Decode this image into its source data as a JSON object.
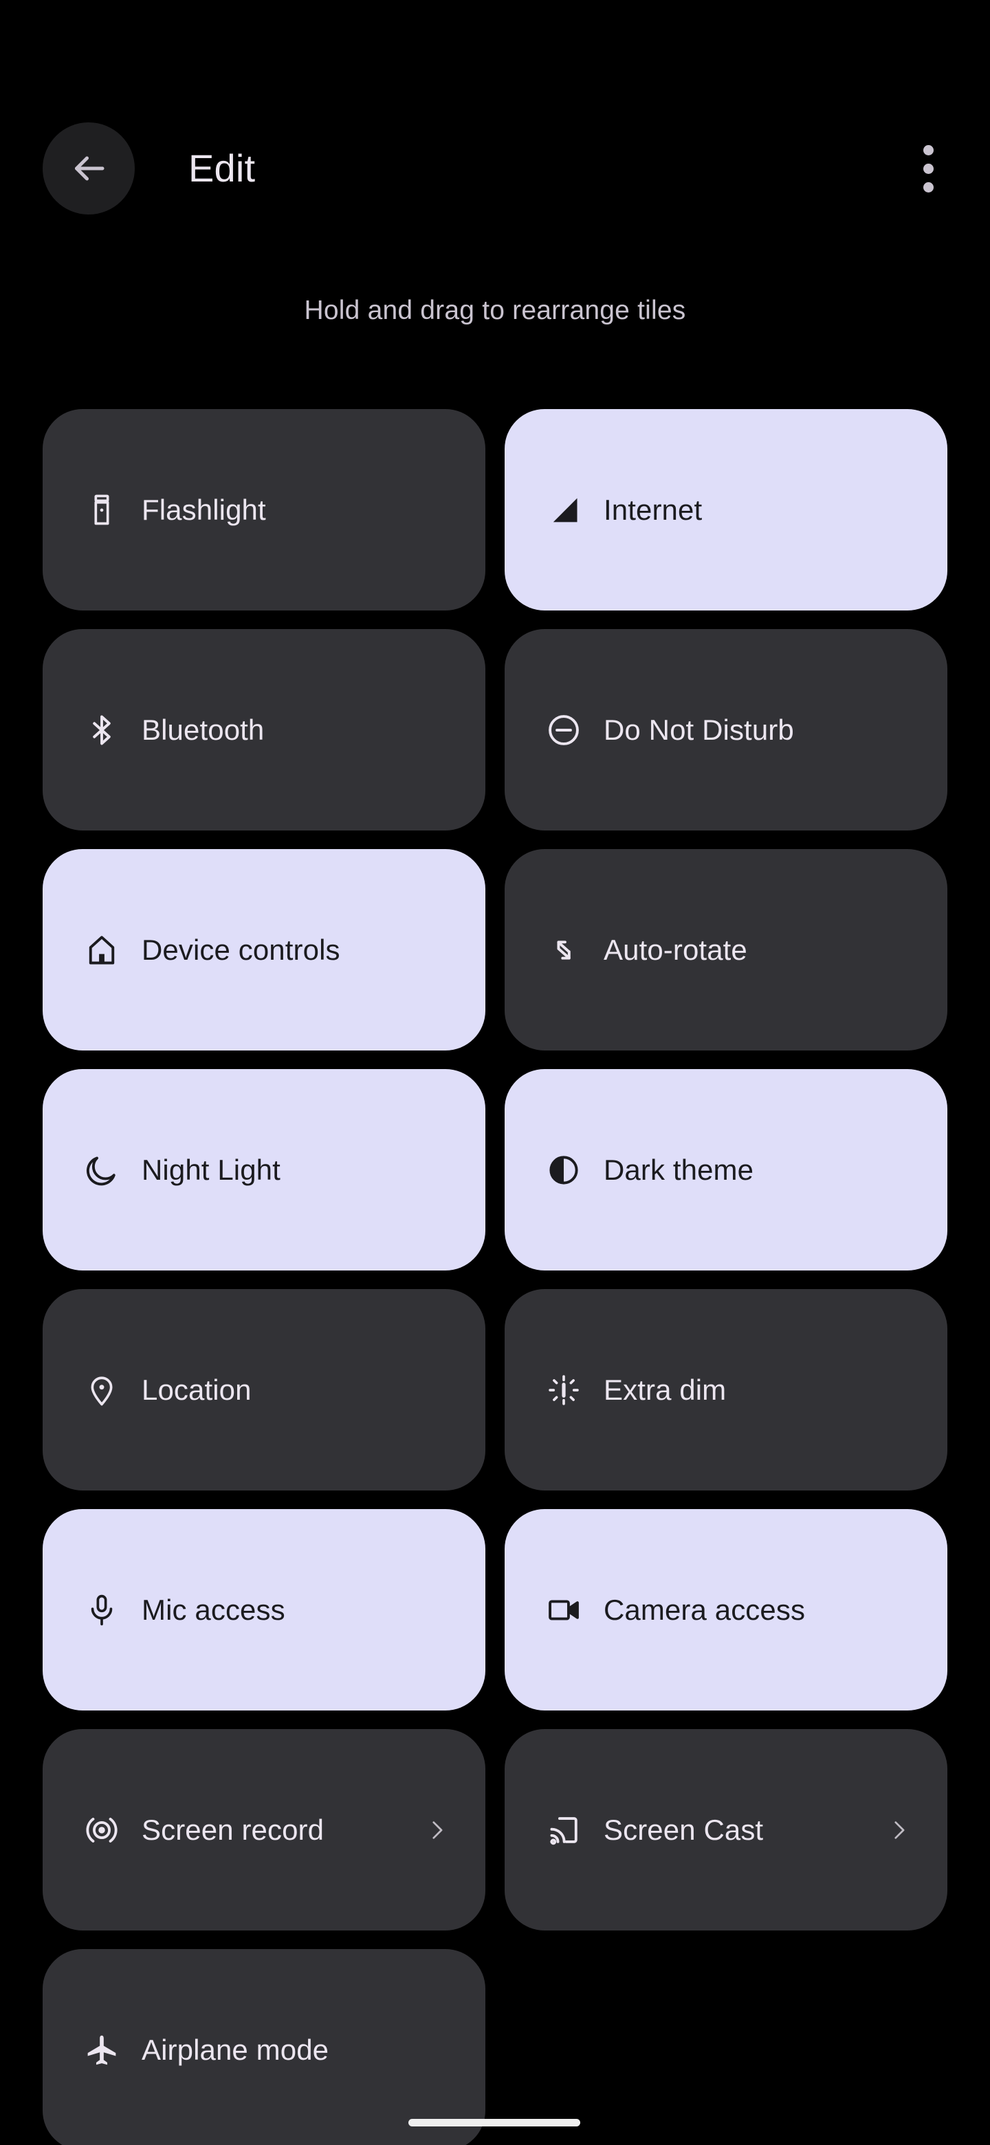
{
  "header": {
    "title": "Edit",
    "back_icon": "arrow-back-icon",
    "overflow_icon": "more-vert-icon"
  },
  "subtitle": "Hold and drag to rearrange tiles",
  "colors": {
    "background": "#000000",
    "tile_inactive_bg": "#323236",
    "tile_inactive_fg": "#ECE6F0",
    "tile_active_bg": "#DFDEF9",
    "tile_active_fg": "#1B1B1F",
    "header_fg": "#ECE6F0",
    "subtitle_fg": "#CAC4D0",
    "back_button_bg": "#1F1F21",
    "nav_pill": "#EFEFEF"
  },
  "tiles": [
    {
      "label": "Flashlight",
      "icon": "flashlight-icon",
      "state": "inactive",
      "chevron": false
    },
    {
      "label": "Internet",
      "icon": "signal-internet-icon",
      "state": "active",
      "chevron": false
    },
    {
      "label": "Bluetooth",
      "icon": "bluetooth-icon",
      "state": "inactive",
      "chevron": false
    },
    {
      "label": "Do Not Disturb",
      "icon": "do-not-disturb-icon",
      "state": "inactive",
      "chevron": false
    },
    {
      "label": "Device controls",
      "icon": "home-icon",
      "state": "active",
      "chevron": false
    },
    {
      "label": "Auto-rotate",
      "icon": "auto-rotate-icon",
      "state": "inactive",
      "chevron": false
    },
    {
      "label": "Night Light",
      "icon": "moon-icon",
      "state": "active",
      "chevron": false
    },
    {
      "label": "Dark theme",
      "icon": "dark-theme-icon",
      "state": "active",
      "chevron": false
    },
    {
      "label": "Location",
      "icon": "location-pin-icon",
      "state": "inactive",
      "chevron": false
    },
    {
      "label": "Extra dim",
      "icon": "extra-dim-icon",
      "state": "inactive",
      "chevron": false
    },
    {
      "label": "Mic access",
      "icon": "microphone-icon",
      "state": "active",
      "chevron": false
    },
    {
      "label": "Camera access",
      "icon": "video-camera-icon",
      "state": "active",
      "chevron": false
    },
    {
      "label": "Screen record",
      "icon": "screen-record-icon",
      "state": "inactive",
      "chevron": true
    },
    {
      "label": "Screen Cast",
      "icon": "cast-icon",
      "state": "inactive",
      "chevron": true
    },
    {
      "label": "Airplane mode",
      "icon": "airplane-icon",
      "state": "inactive",
      "chevron": false
    }
  ],
  "nav_bar": {
    "gesture_pill": "home-gesture-pill"
  }
}
